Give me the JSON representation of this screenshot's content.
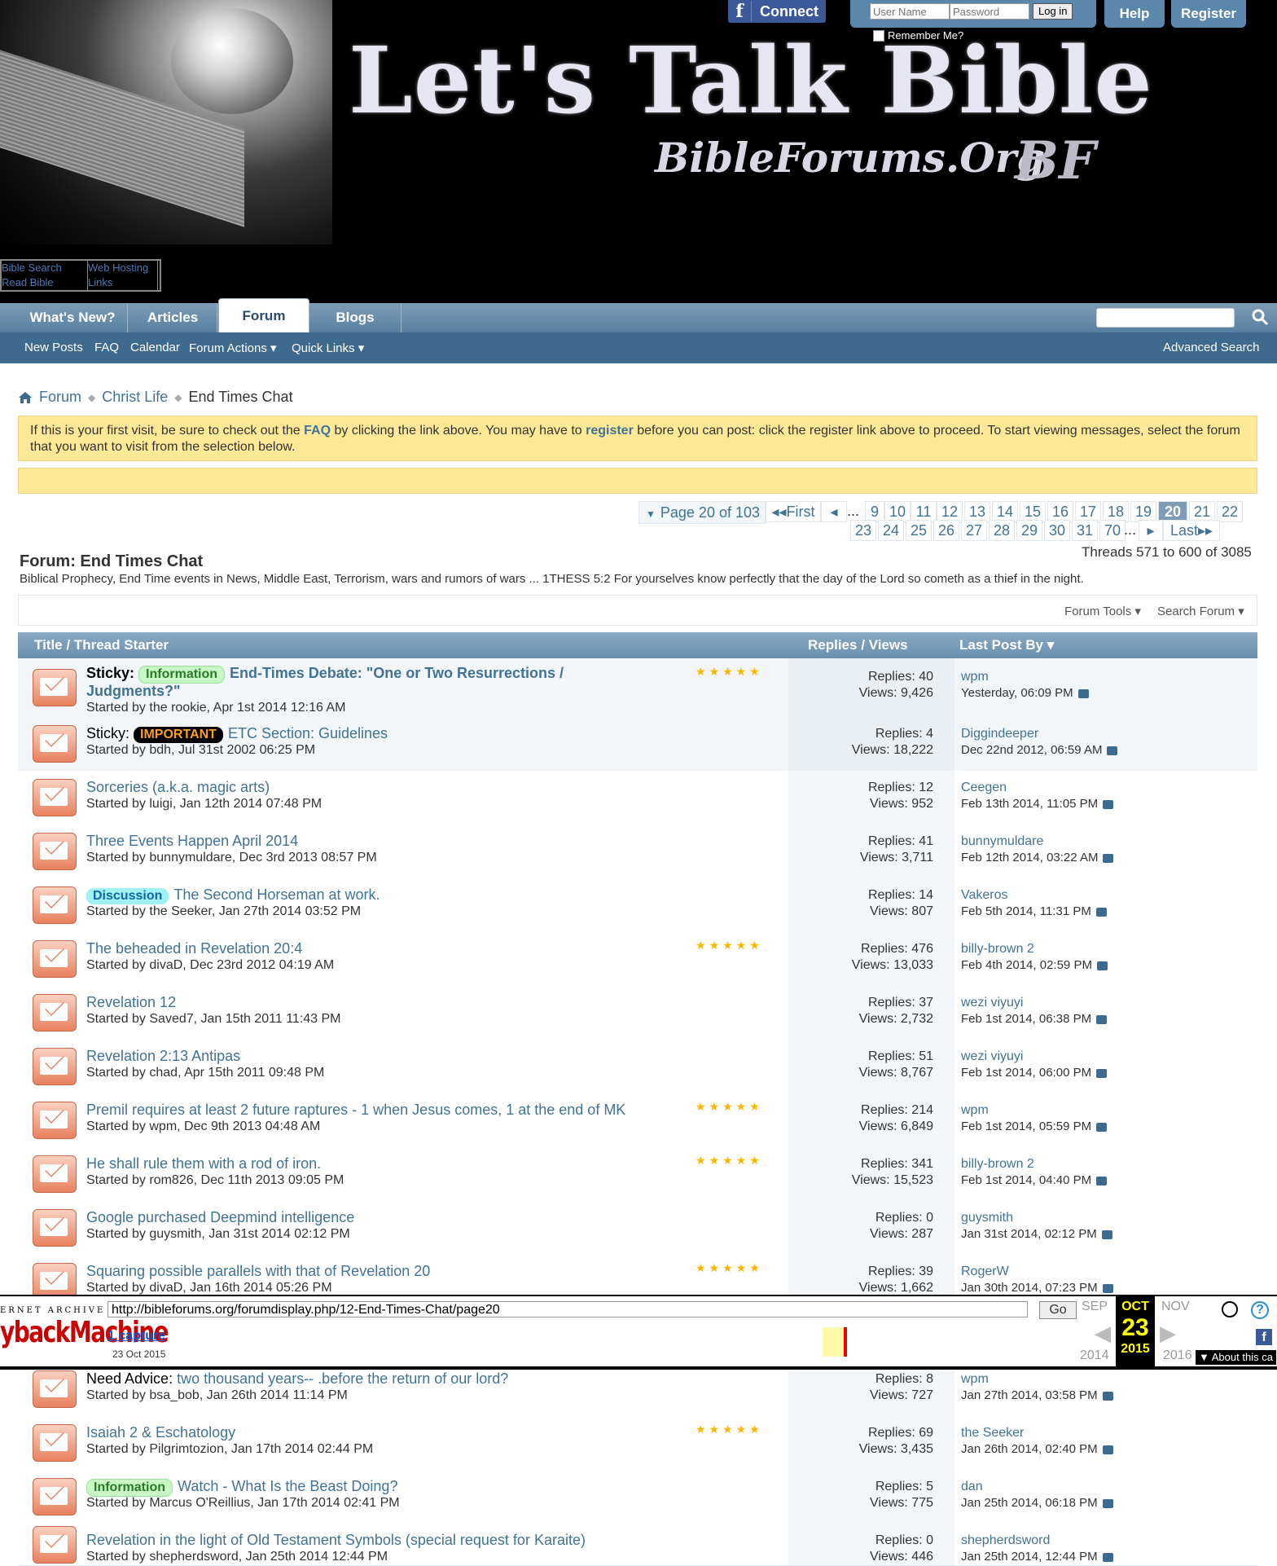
{
  "header": {
    "site_title": "Let's Talk Bible",
    "site_subtitle": "BibleForums.Org",
    "site_mark": "BF",
    "fb_connect": "Connect",
    "username_placeholder": "User Name",
    "password_placeholder": "Password",
    "login_label": "Log in",
    "remember_label": "Remember Me?",
    "help_label": "Help",
    "register_label": "Register",
    "mini_links": [
      "Bible Search",
      "Web Hosting",
      "Read Bible",
      "Links"
    ]
  },
  "nav": {
    "tabs": [
      "What's New?",
      "Articles",
      "Forum",
      "Blogs"
    ],
    "active_tab": "Forum",
    "sub": [
      "New Posts",
      "FAQ",
      "Calendar",
      "Forum Actions",
      "Quick Links"
    ],
    "advanced_search": "Advanced Search"
  },
  "breadcrumb": [
    "Forum",
    "Christ Life",
    "End Times Chat"
  ],
  "notice": {
    "part1": "If this is your first visit, be sure to check out the ",
    "faq": "FAQ",
    "part2": " by clicking the link above. You may have to ",
    "register": "register",
    "part3": " before you can post: click the register link above to proceed. To start viewing messages, select the forum that you want to visit from the selection below."
  },
  "pagination": {
    "label": "Page 20 of 103",
    "first": "First",
    "ellipsis": "...",
    "row1": [
      "9",
      "10",
      "11",
      "12",
      "13",
      "14",
      "15",
      "16",
      "17",
      "18",
      "19",
      "20",
      "21",
      "22"
    ],
    "row2": [
      "23",
      "24",
      "25",
      "26",
      "27",
      "28",
      "29",
      "30",
      "31",
      "70"
    ],
    "current": "20",
    "last": "Last",
    "threads_count": "Threads 571 to 600 of 3085"
  },
  "forum": {
    "title": "Forum: End Times Chat",
    "description": "Biblical Prophecy, End Time events in News, Middle East, Terrorism, wars and rumors of wars ... 1THESS 5:2 For yourselves know perfectly that the day of the Lord so cometh as a thief in the night.",
    "tools": "Forum Tools",
    "search": "Search Forum"
  },
  "table_header": {
    "title": "Title / Thread Starter",
    "replies": "Replies",
    "views": "Views",
    "slash": " / ",
    "last_post": "Last Post By"
  },
  "threads": [
    {
      "sticky": "Sticky:",
      "prefix": "Information",
      "prefix_type": "info",
      "title": "End-Times Debate: \"One or Two Resurrections /",
      "title2": "Judgments?\"",
      "starter": "Started by the rookie, Apr 1st 2014 12:16 AM",
      "replies": "Replies: 40",
      "views": "Views: 9,426",
      "lp_user": "wpm",
      "lp_date": "Yesterday, 06:09 PM",
      "stars": "★★★★★"
    },
    {
      "sticky": "Sticky:",
      "prefix": "IMPORTANT",
      "prefix_type": "imp",
      "title": "ETC Section: Guidelines",
      "starter": "Started by bdh, Jul 31st 2002 06:25 PM",
      "replies": "Replies: 4",
      "views": "Views: 18,222",
      "lp_user": "Diggindeeper",
      "lp_date": "Dec 22nd 2012, 06:59 AM"
    },
    {
      "title": "Sorceries (a.k.a. magic arts)",
      "starter": "Started by luigi, Jan 12th 2014 07:48 PM",
      "replies": "Replies: 12",
      "views": "Views: 952",
      "lp_user": "Ceegen",
      "lp_date": "Feb 13th 2014, 11:05 PM"
    },
    {
      "title": "Three Events Happen April 2014",
      "starter": "Started by bunnymuldare, Dec 3rd 2013 08:57 PM",
      "replies": "Replies: 41",
      "views": "Views: 3,711",
      "lp_user": "bunnymuldare",
      "lp_date": "Feb 12th 2014, 03:22 AM"
    },
    {
      "prefix": "Discussion",
      "prefix_type": "disc",
      "title": "The Second Horseman at work.",
      "starter": "Started by the Seeker, Jan 27th 2014 03:52 PM",
      "replies": "Replies: 14",
      "views": "Views: 807",
      "lp_user": "Vakeros",
      "lp_date": "Feb 5th 2014, 11:31 PM"
    },
    {
      "title": "The beheaded in Revelation 20:4",
      "starter": "Started by divaD, Dec 23rd 2012 04:19 AM",
      "replies": "Replies: 476",
      "views": "Views: 13,033",
      "lp_user": "billy-brown 2",
      "lp_date": "Feb 4th 2014, 02:59 PM",
      "stars": "★★★★★"
    },
    {
      "title": "Revelation 12",
      "starter": "Started by Saved7, Jan 15th 2011 11:43 PM",
      "replies": "Replies: 37",
      "views": "Views: 2,732",
      "lp_user": "wezi viyuyi",
      "lp_date": "Feb 1st 2014, 06:38 PM"
    },
    {
      "title": "Revelation 2:13 Antipas",
      "starter": "Started by chad, Apr 15th 2011 09:48 PM",
      "replies": "Replies: 51",
      "views": "Views: 8,767",
      "lp_user": "wezi viyuyi",
      "lp_date": "Feb 1st 2014, 06:00 PM"
    },
    {
      "title": "Premil requires at least 2 future raptures - 1 when Jesus comes, 1 at the end of MK",
      "starter": "Started by wpm, Dec 9th 2013 04:48 AM",
      "replies": "Replies: 214",
      "views": "Views: 6,849",
      "lp_user": "wpm",
      "lp_date": "Feb 1st 2014, 05:59 PM",
      "stars": "★★★★★"
    },
    {
      "title": "He shall rule them with a rod of iron.",
      "starter": "Started by rom826, Dec 11th 2013 09:05 PM",
      "replies": "Replies: 341",
      "views": "Views: 15,523",
      "lp_user": "billy-brown 2",
      "lp_date": "Feb 1st 2014, 04:40 PM",
      "stars": "★★★★★"
    },
    {
      "title": "Google purchased Deepmind intelligence",
      "starter": "Started by guysmith, Jan 31st 2014 02:12 PM",
      "replies": "Replies: 0",
      "views": "Views: 287",
      "lp_user": "guysmith",
      "lp_date": "Jan 31st 2014, 02:12 PM"
    },
    {
      "title": "Squaring possible parallels with that of Revelation 20",
      "starter": "Started by divaD, Jan 16th 2014 05:26 PM",
      "replies": "Replies: 39",
      "views": "Views: 1,662",
      "lp_user": "RogerW",
      "lp_date": "Jan 30th 2014, 07:23 PM",
      "stars": "★★★★★"
    },
    {
      "prefix_plain": "Need Advice:",
      "title": "two thousand years-- .before the return of our lord?",
      "starter": "Started by bsa_bob, Jan 26th 2014 11:14 PM",
      "replies": "Replies: 8",
      "views": "Views: 727",
      "lp_user": "wpm",
      "lp_date": "Jan 27th 2014, 03:58 PM"
    },
    {
      "title": "Isaiah 2 & Eschatology",
      "starter": "Started by Pilgrimtozion, Jan 17th 2014 02:44 PM",
      "replies": "Replies: 69",
      "views": "Views: 3,435",
      "lp_user": "the Seeker",
      "lp_date": "Jan 26th 2014, 02:40 PM",
      "stars": "★★★★★"
    },
    {
      "prefix": "Information",
      "prefix_type": "info",
      "title": "Watch - What Is the Beast Doing?",
      "starter": "Started by Marcus O'Reillius, Jan 17th 2014 02:41 PM",
      "replies": "Replies: 5",
      "views": "Views: 775",
      "lp_user": "dan",
      "lp_date": "Jan 25th 2014, 06:18 PM"
    },
    {
      "title": "Revelation in the light of Old Testament Symbols (special request for Karaite)",
      "starter": "Started by shepherdsword, Jan 25th 2014 12:44 PM",
      "replies": "Replies: 0",
      "views": "Views: 446",
      "lp_user": "shepherdsword",
      "lp_date": "Jan 25th 2014, 12:44 PM"
    }
  ],
  "wayback": {
    "logo_top": "ERNET ARCHIVE",
    "logo_main": "ybackMachine",
    "url": "http://bibleforums.org/forumdisplay.php/12-End-Times-Chat/page20",
    "go": "Go",
    "captures": "1 capture",
    "capture_date": "23 Oct 2015",
    "prev_month": "SEP",
    "cur_month": "OCT",
    "next_month": "NOV",
    "day": "23",
    "prev_year": "2014",
    "cur_year": "2015",
    "next_year": "2016",
    "about": "About this ca"
  }
}
